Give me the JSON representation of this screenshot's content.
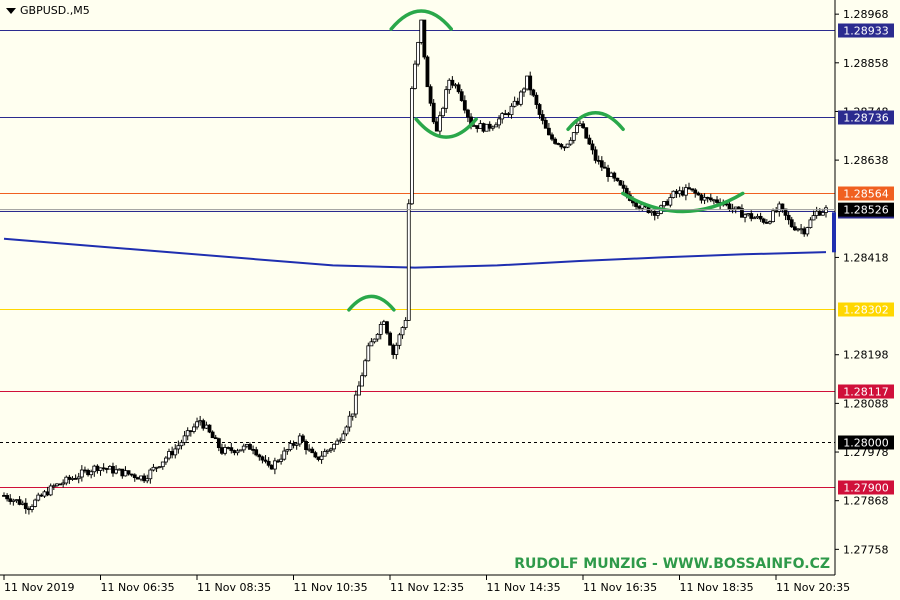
{
  "symbol": "GBPUSD.,M5",
  "watermark": "RUDOLF MUNZIG - WWW.BOSSAINFO.CZ",
  "colors": {
    "background": "#fffff0",
    "bull": "#ffffff",
    "bear": "#000000",
    "ma": "#1f2fb0",
    "annotation": "#2aa84a"
  },
  "chart_data": {
    "type": "candlestick",
    "ylim": [
      1.277,
      1.29
    ],
    "y_ticks": [
      "1.28968",
      "1.28858",
      "1.28748",
      "1.28638",
      "1.28418",
      "1.28198",
      "1.28088",
      "1.27978",
      "1.27868",
      "1.27758"
    ],
    "x_ticks": [
      "11 Nov 2019",
      "11 Nov 06:35",
      "11 Nov 08:35",
      "11 Nov 10:35",
      "11 Nov 12:35",
      "11 Nov 14:35",
      "11 Nov 16:35",
      "11 Nov 18:35",
      "11 Nov 20:35"
    ],
    "current_price": "1.28526",
    "levels": [
      {
        "value": 1.28933,
        "label": "1.28933",
        "color": "#2b2b8f",
        "tag_bg": "#2b2b8f",
        "tag_fg": "#ffffff",
        "dashed": false
      },
      {
        "value": 1.28736,
        "label": "1.28736",
        "color": "#2b2b8f",
        "tag_bg": "#2b2b8f",
        "tag_fg": "#ffffff",
        "dashed": false
      },
      {
        "value": 1.28564,
        "label": "1.28564",
        "color": "#f06020",
        "tag_bg": "#f06020",
        "tag_fg": "#ffffff",
        "dashed": false
      },
      {
        "value": 1.28522,
        "label": "1.28522",
        "color": "#2b2b8f",
        "tag_bg": "#2b2b8f",
        "tag_fg": "#ffffff",
        "dashed": false
      },
      {
        "value": 1.28302,
        "label": "1.28302",
        "color": "#ffd700",
        "tag_bg": "#ffd700",
        "tag_fg": "#ffffff",
        "dashed": false
      },
      {
        "value": 1.28117,
        "label": "1.28117",
        "color": "#d0103a",
        "tag_bg": "#d0103a",
        "tag_fg": "#ffffff",
        "dashed": false
      },
      {
        "value": 1.28,
        "label": "1.28000",
        "color": "#000000",
        "tag_bg": "#000000",
        "tag_fg": "#ffffff",
        "dashed": true
      },
      {
        "value": 1.279,
        "label": "1.27900",
        "color": "#d0103a",
        "tag_bg": "#d0103a",
        "tag_fg": "#ffffff",
        "dashed": false
      }
    ],
    "moving_average": [
      1.2846,
      1.28445,
      1.2843,
      1.28415,
      1.284,
      1.28395,
      1.284,
      1.2841,
      1.28418,
      1.28425,
      1.2843
    ],
    "waypoints": [
      [
        0,
        1.2788
      ],
      [
        8,
        1.27855
      ],
      [
        16,
        1.279
      ],
      [
        30,
        1.27945
      ],
      [
        45,
        1.2792
      ],
      [
        55,
        1.27985
      ],
      [
        63,
        1.2805
      ],
      [
        70,
        1.2798
      ],
      [
        80,
        1.2799
      ],
      [
        85,
        1.2794
      ],
      [
        95,
        1.2801
      ],
      [
        100,
        1.2796
      ],
      [
        107,
        1.28
      ],
      [
        112,
        1.2807
      ],
      [
        117,
        1.2821
      ],
      [
        122,
        1.2828
      ],
      [
        125,
        1.282
      ],
      [
        129,
        1.2828
      ],
      [
        131,
        1.288
      ],
      [
        134,
        1.2895
      ],
      [
        136,
        1.288
      ],
      [
        139,
        1.287
      ],
      [
        143,
        1.2882
      ],
      [
        146,
        1.288
      ],
      [
        150,
        1.2872
      ],
      [
        155,
        1.2871
      ],
      [
        161,
        1.2874
      ],
      [
        165,
        1.2877
      ],
      [
        168,
        1.2882
      ],
      [
        172,
        1.2874
      ],
      [
        175,
        1.2869
      ],
      [
        180,
        1.2867
      ],
      [
        185,
        1.2872
      ],
      [
        190,
        1.2864
      ],
      [
        195,
        1.286
      ],
      [
        200,
        1.2856
      ],
      [
        205,
        1.2853
      ],
      [
        210,
        1.2852
      ],
      [
        215,
        1.2856
      ],
      [
        220,
        1.2857
      ],
      [
        225,
        1.2855
      ],
      [
        230,
        1.28545
      ],
      [
        236,
        1.2852
      ],
      [
        240,
        1.2851
      ],
      [
        245,
        1.285
      ],
      [
        249,
        1.2853
      ],
      [
        253,
        1.2849
      ],
      [
        257,
        1.2848
      ],
      [
        261,
        1.2852
      ],
      [
        264,
        1.28526
      ]
    ],
    "annotations": [
      {
        "type": "arc-top",
        "bar": 134,
        "price": 1.28975,
        "width": 60
      },
      {
        "type": "arc-bottom",
        "bar": 142,
        "price": 1.2869,
        "width": 60
      },
      {
        "type": "arc-top",
        "bar": 190,
        "price": 1.28745,
        "width": 55
      },
      {
        "type": "arc-bottom",
        "bar": 218,
        "price": 1.28522,
        "width": 120
      },
      {
        "type": "arc-top",
        "bar": 118,
        "price": 1.2833,
        "width": 45
      }
    ]
  }
}
